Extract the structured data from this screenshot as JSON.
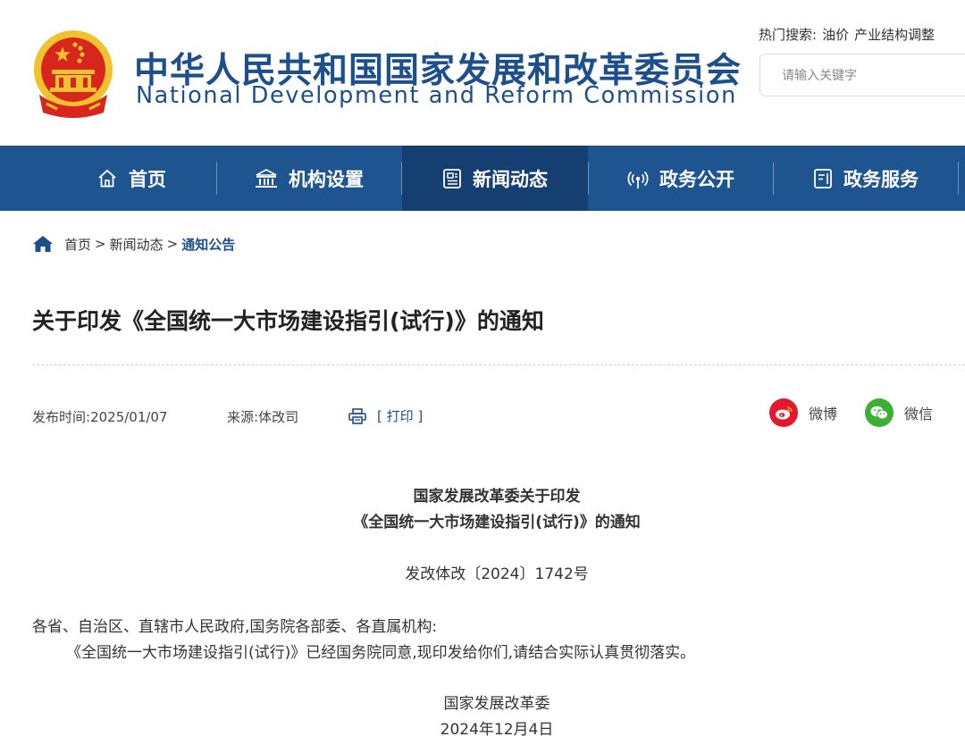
{
  "header": {
    "title_cn": "中华人民共和国国家发展和改革委员会",
    "title_en": "National Development and Reform Commission",
    "hot_search_label": "热门搜索:",
    "hot_search_items": [
      "油价",
      "产业结构调整"
    ],
    "search_placeholder": "请输入关键字"
  },
  "nav": {
    "items": [
      {
        "label": "首页",
        "icon": "home-icon"
      },
      {
        "label": "机构设置",
        "icon": "building-icon"
      },
      {
        "label": "新闻动态",
        "icon": "news-icon"
      },
      {
        "label": "政务公开",
        "icon": "broadcast-icon"
      },
      {
        "label": "政务服务",
        "icon": "document-icon"
      }
    ],
    "active_index": 2
  },
  "breadcrumb": {
    "items": [
      "首页",
      "新闻动态",
      "通知公告"
    ],
    "separator": ">"
  },
  "article": {
    "title": "关于印发《全国统一大市场建设指引(试行)》的通知",
    "publish_time_label": "发布时间:",
    "publish_time": "2025/01/07",
    "source_label": "来源:",
    "source": "体改司",
    "print_label": "[ 打印 ]",
    "share": [
      {
        "label": "微博",
        "icon": "weibo-icon",
        "color": "#e6162d"
      },
      {
        "label": "微信",
        "icon": "wechat-icon",
        "color": "#3cb034"
      }
    ],
    "heading_line1": "国家发展改革委关于印发",
    "heading_line2": "《全国统一大市场建设指引(试行)》的通知",
    "doc_number": "发改体改〔2024〕1742号",
    "recipients": "各省、自治区、直辖市人民政府,国务院各部委、各直属机构:",
    "body": "《全国统一大市场建设指引(试行)》已经国务院同意,现印发给你们,请结合实际认真贯彻落实。",
    "signature": "国家发展改革委",
    "date": "2024年12月4日"
  },
  "colors": {
    "brand_blue": "#1c4f8c",
    "nav_bg": "#1e5590",
    "nav_active": "#153f70",
    "emblem_red": "#d7261e",
    "emblem_gold": "#f2c12e"
  }
}
